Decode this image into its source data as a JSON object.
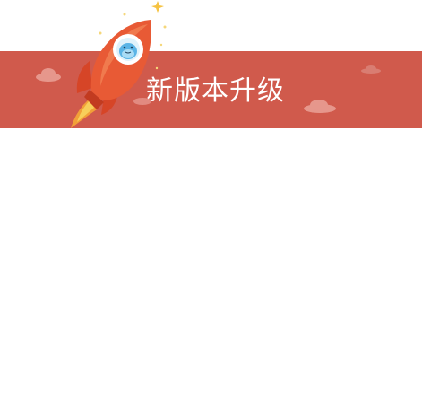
{
  "dialog": {
    "title": "新版本升级",
    "banner_color": "#d05a4c",
    "icons": [
      "rocket-icon",
      "mascot-icon",
      "cloud-icon",
      "star-icon"
    ]
  }
}
